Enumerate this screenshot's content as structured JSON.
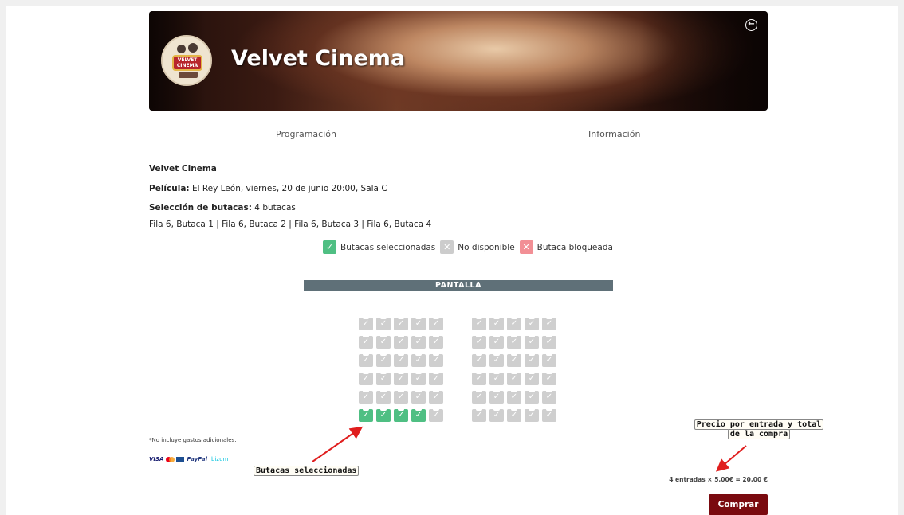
{
  "header": {
    "cinema_name": "Velvet Cinema",
    "logo_text": "VELVET CINEMA"
  },
  "tabs": [
    {
      "label": "Programación"
    },
    {
      "label": "Información"
    }
  ],
  "info": {
    "cinema": "Velvet Cinema",
    "movie_label": "Película:",
    "movie_value": "El Rey León, viernes, 20 de junio 20:00, Sala C",
    "selection_label": "Selección de butacas:",
    "selection_value": "4 butacas",
    "seats_list": "Fila 6, Butaca 1 | Fila 6, Butaca 2 | Fila 6, Butaca 3 | Fila 6, Butaca 4"
  },
  "legend": {
    "selected": "Butacas seleccionadas",
    "unavailable": "No disponible",
    "blocked": "Butaca bloqueada"
  },
  "screen_label": "PANTALLA",
  "seat_map": {
    "rows": 6,
    "seats_per_block": 5,
    "blocks": 2,
    "selected": [
      [
        6,
        1
      ],
      [
        6,
        2
      ],
      [
        6,
        3
      ],
      [
        6,
        4
      ]
    ],
    "colors": {
      "selected": "#4fbf83",
      "unavailable": "#cfcfcf",
      "blocked": "#f28f95"
    }
  },
  "footer": {
    "note": "*No incluye gastos adicionales.",
    "payments": {
      "visa": "VISA",
      "paypal": "PayPal",
      "bizum": "bizum"
    },
    "total": "4 entradas × 5,00€ = 20,00 €",
    "buy_label": "Comprar"
  },
  "annotations": {
    "seats": "Butacas seleccionadas",
    "price_line1": "Precio por entrada y total",
    "price_line2": "de la compra"
  },
  "icons": {
    "back": "arrow-left-circle-icon",
    "check": "check-icon",
    "cross": "cross-icon"
  }
}
